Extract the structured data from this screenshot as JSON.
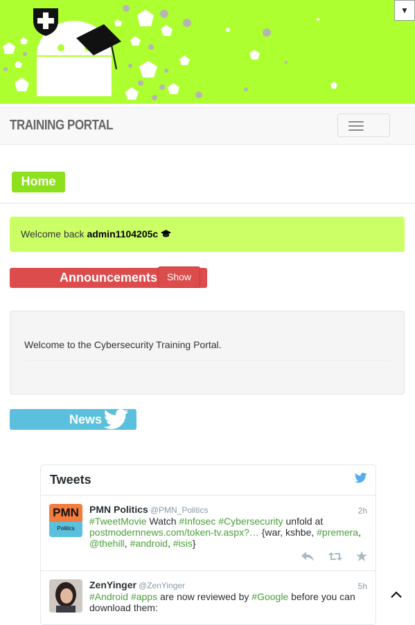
{
  "top_select": {
    "arrow": "▼"
  },
  "navbar": {
    "brand": "TRAINING PORTAL"
  },
  "home": {
    "label": "Home"
  },
  "welcome": {
    "prefix": "Welcome back",
    "user": "admin1104205c"
  },
  "announcements": {
    "title": "Announcements",
    "show_label": "Show"
  },
  "content": {
    "message": "Welcome to the Cybersecurity Training Portal."
  },
  "news": {
    "label": "News"
  },
  "tweets": {
    "title": "Tweets",
    "items": [
      {
        "name": "PMN Politics",
        "handle": "@PMN_Politics",
        "time": "2h",
        "avatar_text": "PMN",
        "avatar_sub": "Politics",
        "parts": [
          {
            "t": "#TweetMovie",
            "h": true
          },
          {
            "t": " Watch ",
            "h": false
          },
          {
            "t": "#Infosec",
            "h": true
          },
          {
            "t": " ",
            "h": false
          },
          {
            "t": "#Cybersecurity",
            "h": true
          },
          {
            "t": " unfold at ",
            "h": false
          },
          {
            "t": "postmodernnews.com/token-tv.aspx?…",
            "h": true
          },
          {
            "t": " {war, kshbe, ",
            "h": false
          },
          {
            "t": "#premera",
            "h": true
          },
          {
            "t": ", ",
            "h": false
          },
          {
            "t": "@thehill",
            "h": true
          },
          {
            "t": ", ",
            "h": false
          },
          {
            "t": "#android",
            "h": true
          },
          {
            "t": ", ",
            "h": false
          },
          {
            "t": "#isis",
            "h": true
          },
          {
            "t": "}",
            "h": false
          }
        ]
      },
      {
        "name": "ZenYinger",
        "handle": "@ZenYinger",
        "time": "5h",
        "parts": [
          {
            "t": "#Android",
            "h": true
          },
          {
            "t": " ",
            "h": false
          },
          {
            "t": "#apps",
            "h": true
          },
          {
            "t": " are now reviewed by ",
            "h": false
          },
          {
            "t": "#Google",
            "h": true
          },
          {
            "t": " before you can download them:",
            "h": false
          }
        ]
      }
    ]
  },
  "icons": {
    "graduation": "graduation-cap-icon",
    "twitter": "twitter-bird-icon",
    "reply": "reply-icon",
    "retweet": "retweet-icon",
    "favorite": "star-icon",
    "scroll_top": "chevron-up-icon"
  },
  "colors": {
    "hero_bg": "#adff2f",
    "home_btn": "#8de01c",
    "welcome_bg": "#ccff66",
    "announcements": "#dc4c4c",
    "news": "#5bc0de",
    "hashtag": "#4a9f3a",
    "twitter_blue": "#55acee"
  }
}
